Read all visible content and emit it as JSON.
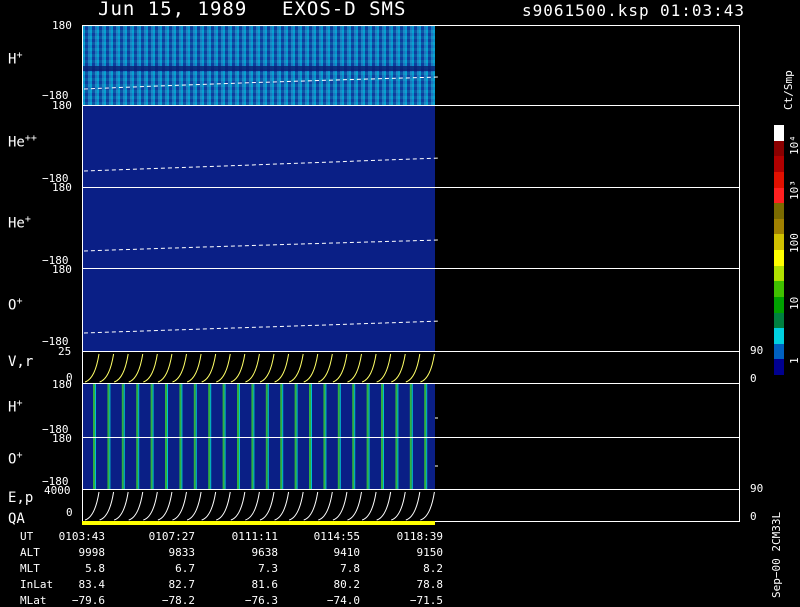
{
  "header": {
    "date": "Jun 15, 1989",
    "instrument": "EXOS-D SMS",
    "file": "s9061500.ksp",
    "time": "01:03:43"
  },
  "panels": [
    {
      "label": "H",
      "sup": "+",
      "top": "180",
      "bottom": "−180"
    },
    {
      "label": "He",
      "sup": "++",
      "top": "180",
      "bottom": "−180"
    },
    {
      "label": "He",
      "sup": "+",
      "top": "180",
      "bottom": "−180"
    },
    {
      "label": "O",
      "sup": "+",
      "top": "180",
      "bottom": "−180"
    }
  ],
  "vr_panel": {
    "label": "V,r",
    "left_top": "25",
    "left_bottom": "0",
    "right_top": "90",
    "right_bottom": "0"
  },
  "h2_panel": {
    "label": "H",
    "sup": "+",
    "top": "180",
    "bottom": "−180"
  },
  "o2_panel": {
    "label": "O",
    "sup": "+",
    "top": "180",
    "bottom": "−180"
  },
  "ep_panel": {
    "label": "E,p",
    "left_top": "4000",
    "left_bottom": "0",
    "right_top": "90",
    "right_bottom": "0"
  },
  "qa_label": "QA",
  "colorbar": {
    "unit": "Ct/Smp",
    "ticks": [
      "10⁴",
      "10³",
      "100",
      "10",
      "1"
    ],
    "colors": [
      "#ffffff",
      "#8a0000",
      "#b00000",
      "#e01000",
      "#ff2020",
      "#7a6a00",
      "#a08000",
      "#d0c000",
      "#ffff00",
      "#b0e000",
      "#40c000",
      "#00a000",
      "#008040",
      "#00d0e0",
      "#0060c0",
      "#000090"
    ]
  },
  "footer_rows": [
    {
      "name": "UT",
      "values": [
        "0103:43",
        "0107:27",
        "0111:11",
        "0114:55",
        "0118:39"
      ]
    },
    {
      "name": "ALT",
      "values": [
        "9998",
        "9833",
        "9638",
        "9410",
        "9150"
      ]
    },
    {
      "name": "MLT",
      "values": [
        "5.8",
        "6.7",
        "7.3",
        "7.8",
        "8.2"
      ]
    },
    {
      "name": "InLat",
      "values": [
        "83.4",
        "82.7",
        "81.6",
        "80.2",
        "78.8"
      ]
    },
    {
      "name": "MLat",
      "values": [
        "−79.6",
        "−78.2",
        "−76.3",
        "−74.0",
        "−71.5"
      ]
    }
  ],
  "side_note": "Sep−00  2CM33L"
}
